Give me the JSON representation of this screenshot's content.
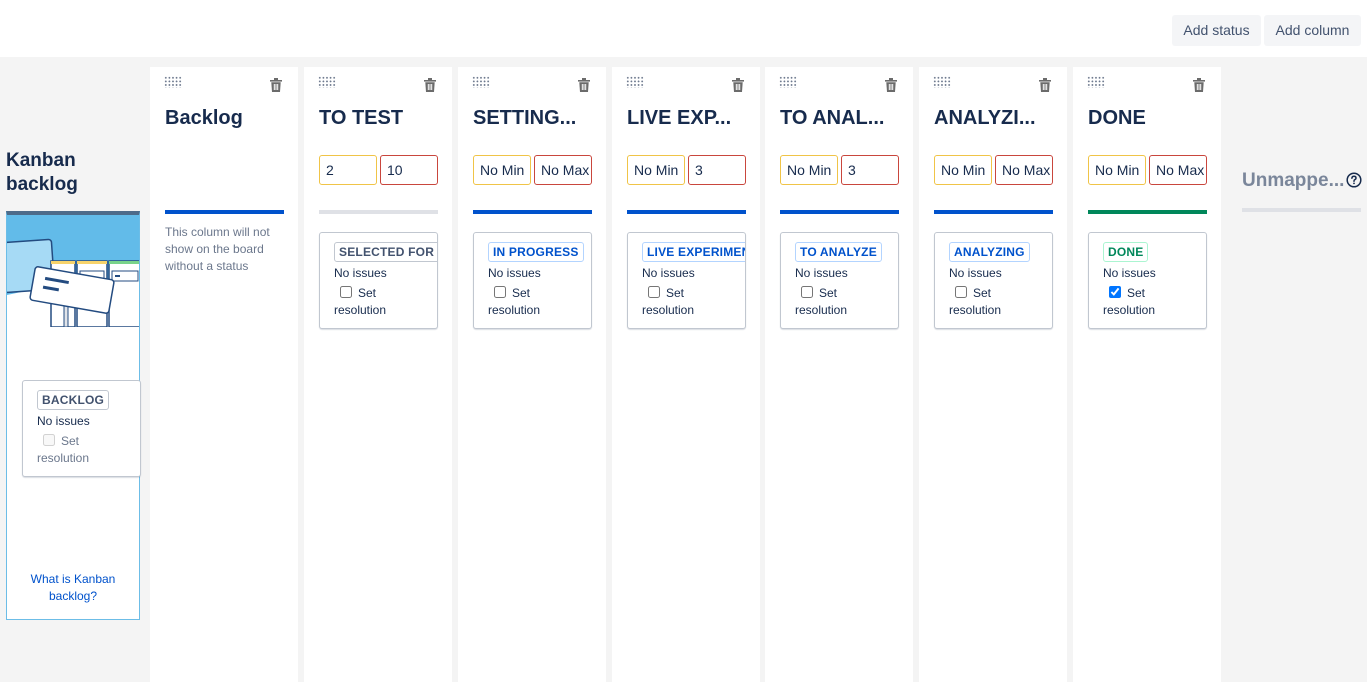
{
  "toolbar": {
    "add_status": "Add status",
    "add_column": "Add column"
  },
  "backlog_panel": {
    "title": "Kanban backlog",
    "card": {
      "status": "BACKLOG",
      "issues": "No issues",
      "set_resolution": "Set resolution",
      "resolution_checked": false,
      "resolution_disabled": true
    },
    "help_link": "What is Kanban backlog?"
  },
  "columns": [
    {
      "title": "Backlog",
      "bar_color": "#0052cc",
      "note": "This column will not show on the board without a status"
    },
    {
      "title": "TO TEST",
      "min": "2",
      "max": "10",
      "bar_color": "#dfe1e6",
      "card": {
        "status": "SELECTED FOR DEVELOPMENT",
        "lozenge": "grey",
        "issues": "No issues",
        "set_resolution": "Set resolution",
        "resolution_checked": false
      }
    },
    {
      "title": "SETTING...",
      "min": "No Min",
      "max": "No Max",
      "bar_color": "#0052cc",
      "card": {
        "status": "IN PROGRESS",
        "lozenge": "blue",
        "issues": "No issues",
        "set_resolution": "Set resolution",
        "resolution_checked": false
      }
    },
    {
      "title": "LIVE EXP...",
      "min": "No Min",
      "max": "3",
      "bar_color": "#0052cc",
      "card": {
        "status": "LIVE EXPERIMENT",
        "lozenge": "blue",
        "issues": "No issues",
        "set_resolution": "Set resolution",
        "resolution_checked": false
      }
    },
    {
      "title": "TO ANAL...",
      "min": "No Min",
      "max": "3",
      "bar_color": "#0052cc",
      "card": {
        "status": "TO ANALYZE",
        "lozenge": "blue",
        "issues": "No issues",
        "set_resolution": "Set resolution",
        "resolution_checked": false
      }
    },
    {
      "title": "ANALYZI...",
      "min": "No Min",
      "max": "No Max",
      "bar_color": "#0052cc",
      "card": {
        "status": "ANALYZING",
        "lozenge": "blue",
        "issues": "No issues",
        "set_resolution": "Set resolution",
        "resolution_checked": false
      }
    },
    {
      "title": "DONE",
      "min": "No Min",
      "max": "No Max",
      "bar_color": "#00875a",
      "card": {
        "status": "DONE",
        "lozenge": "green",
        "issues": "No issues",
        "set_resolution": "Set resolution",
        "resolution_checked": true
      }
    }
  ],
  "unmapped": {
    "title": "Unmappe...",
    "help_icon": "question-circle-icon"
  },
  "icons": {
    "drag": "drag-handle-icon",
    "delete": "trash-icon"
  }
}
